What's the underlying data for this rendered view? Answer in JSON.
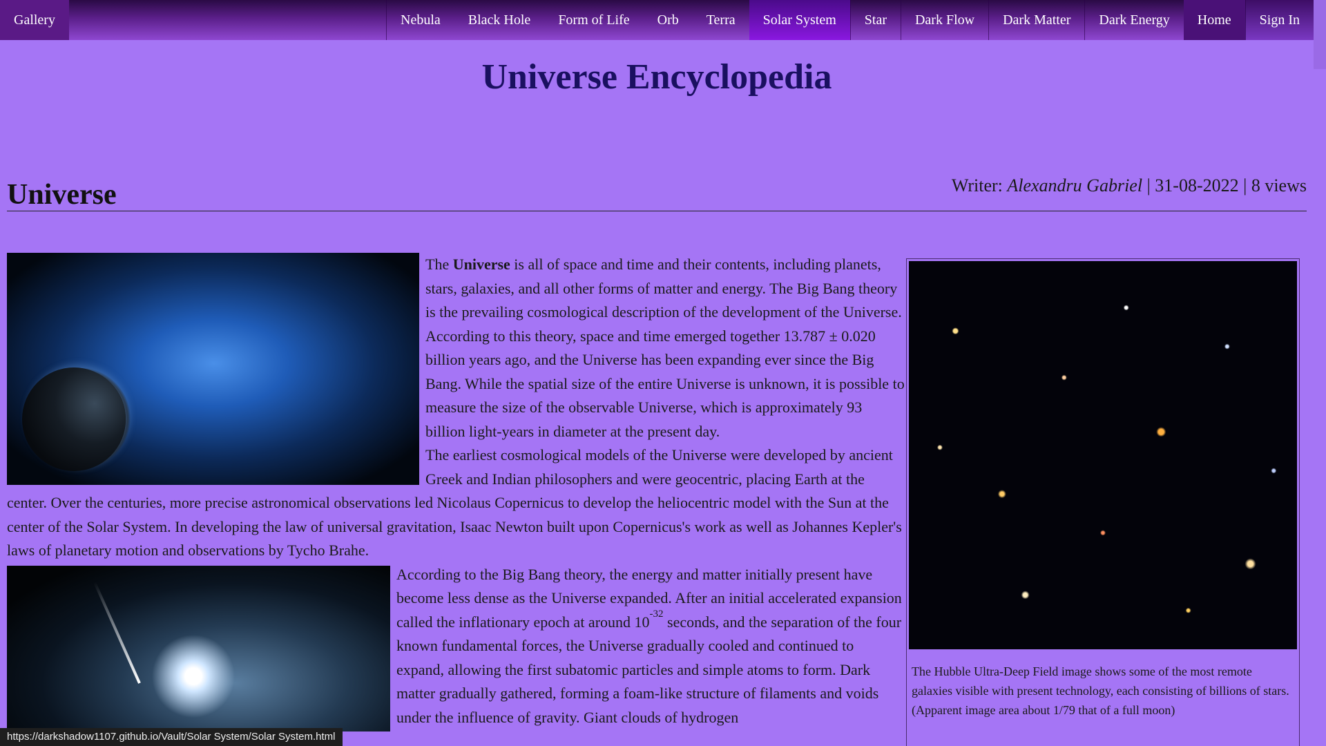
{
  "nav": {
    "gallery": "Gallery",
    "items": [
      "Nebula",
      "Black Hole",
      "Form of Life",
      "Orb",
      "Terra",
      "Solar System",
      "Star",
      "Dark Flow",
      "Dark Matter",
      "Dark Energy"
    ],
    "active": "Solar System",
    "home": "Home",
    "sign_in": "Sign In"
  },
  "site": {
    "title": "Universe Encyclopedia"
  },
  "article": {
    "title": "Universe",
    "writer_label": "Writer:",
    "writer": "Alexandru Gabriel",
    "date": "31-08-2022",
    "views": "8 views",
    "p1_prefix": "The ",
    "p1_bold": "Universe",
    "p1_rest": " is all of space and time and their contents, including planets, stars, galaxies, and all other forms of matter and energy. The Big Bang theory is the prevailing cosmological description of the development of the Universe. According to this theory, space and time emerged together 13.787 ± 0.020 billion years ago, and the Universe has been expanding ever since the Big Bang. While the spatial size of the entire Universe is unknown, it is possible to measure the size of the observable Universe, which is approximately 93 billion light-years in diameter at the present day.",
    "p2": "The earliest cosmological models of the Universe were developed by ancient Greek and Indian philosophers and were geocentric, placing Earth at the center. Over the centuries, more precise astronomical observations led Nicolaus Copernicus to develop the heliocentric model with the Sun at the center of the Solar System. In developing the law of universal gravitation, Isaac Newton built upon Copernicus's work as well as Johannes Kepler's laws of planetary motion and observations by Tycho Brahe.",
    "p3_a": "According to the Big Bang theory, the energy and matter initially present have become less dense as the Universe expanded. After an initial accelerated expansion called the inflationary epoch at around 10",
    "p3_sup": "-32",
    "p3_b": " seconds, and the separation of the four known fundamental forces, the Universe gradually cooled and continued to expand, allowing the first subatomic particles and simple atoms to form. Dark matter gradually gathered, forming a foam-like structure of filaments and voids under the influence of gravity. Giant clouds of hydrogen"
  },
  "figure": {
    "caption": "The Hubble Ultra-Deep Field image shows some of the most remote galaxies visible with present technology, each consisting of billions of stars. (Apparent image area about 1/79 that of a full moon)"
  },
  "status_url": "https://darkshadow1107.github.io/Vault/Solar System/Solar System.html"
}
